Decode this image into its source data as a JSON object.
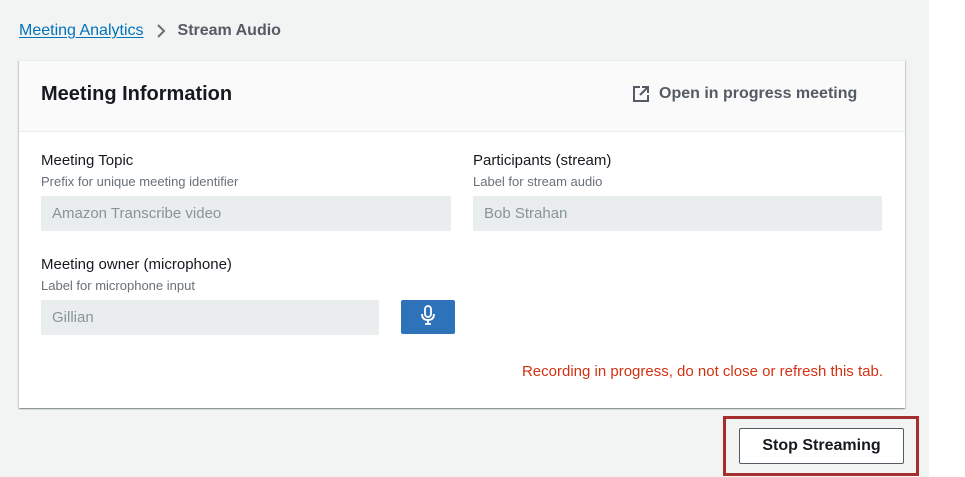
{
  "breadcrumb": {
    "parent": "Meeting Analytics",
    "current": "Stream Audio"
  },
  "panel": {
    "title": "Meeting Information",
    "external_link": "Open in progress meeting"
  },
  "fields": {
    "meeting_topic": {
      "label": "Meeting Topic",
      "description": "Prefix for unique meeting identifier",
      "value": "Amazon Transcribe video"
    },
    "participants": {
      "label": "Participants (stream)",
      "description": "Label for stream audio",
      "value": "Bob Strahan"
    },
    "owner": {
      "label": "Meeting owner (microphone)",
      "description": "Label for microphone input",
      "value": "Gillian"
    }
  },
  "warning": "Recording in progress, do not close or refresh this tab.",
  "stop_button": "Stop Streaming",
  "colors": {
    "link": "#0073bb",
    "primary_button": "#2e72b9",
    "warning": "#d13212",
    "highlight": "#a52f2f"
  },
  "icons": {
    "breadcrumb_separator": "chevron-right-icon",
    "external_link": "external-link-icon",
    "mic_button": "microphone-icon"
  }
}
